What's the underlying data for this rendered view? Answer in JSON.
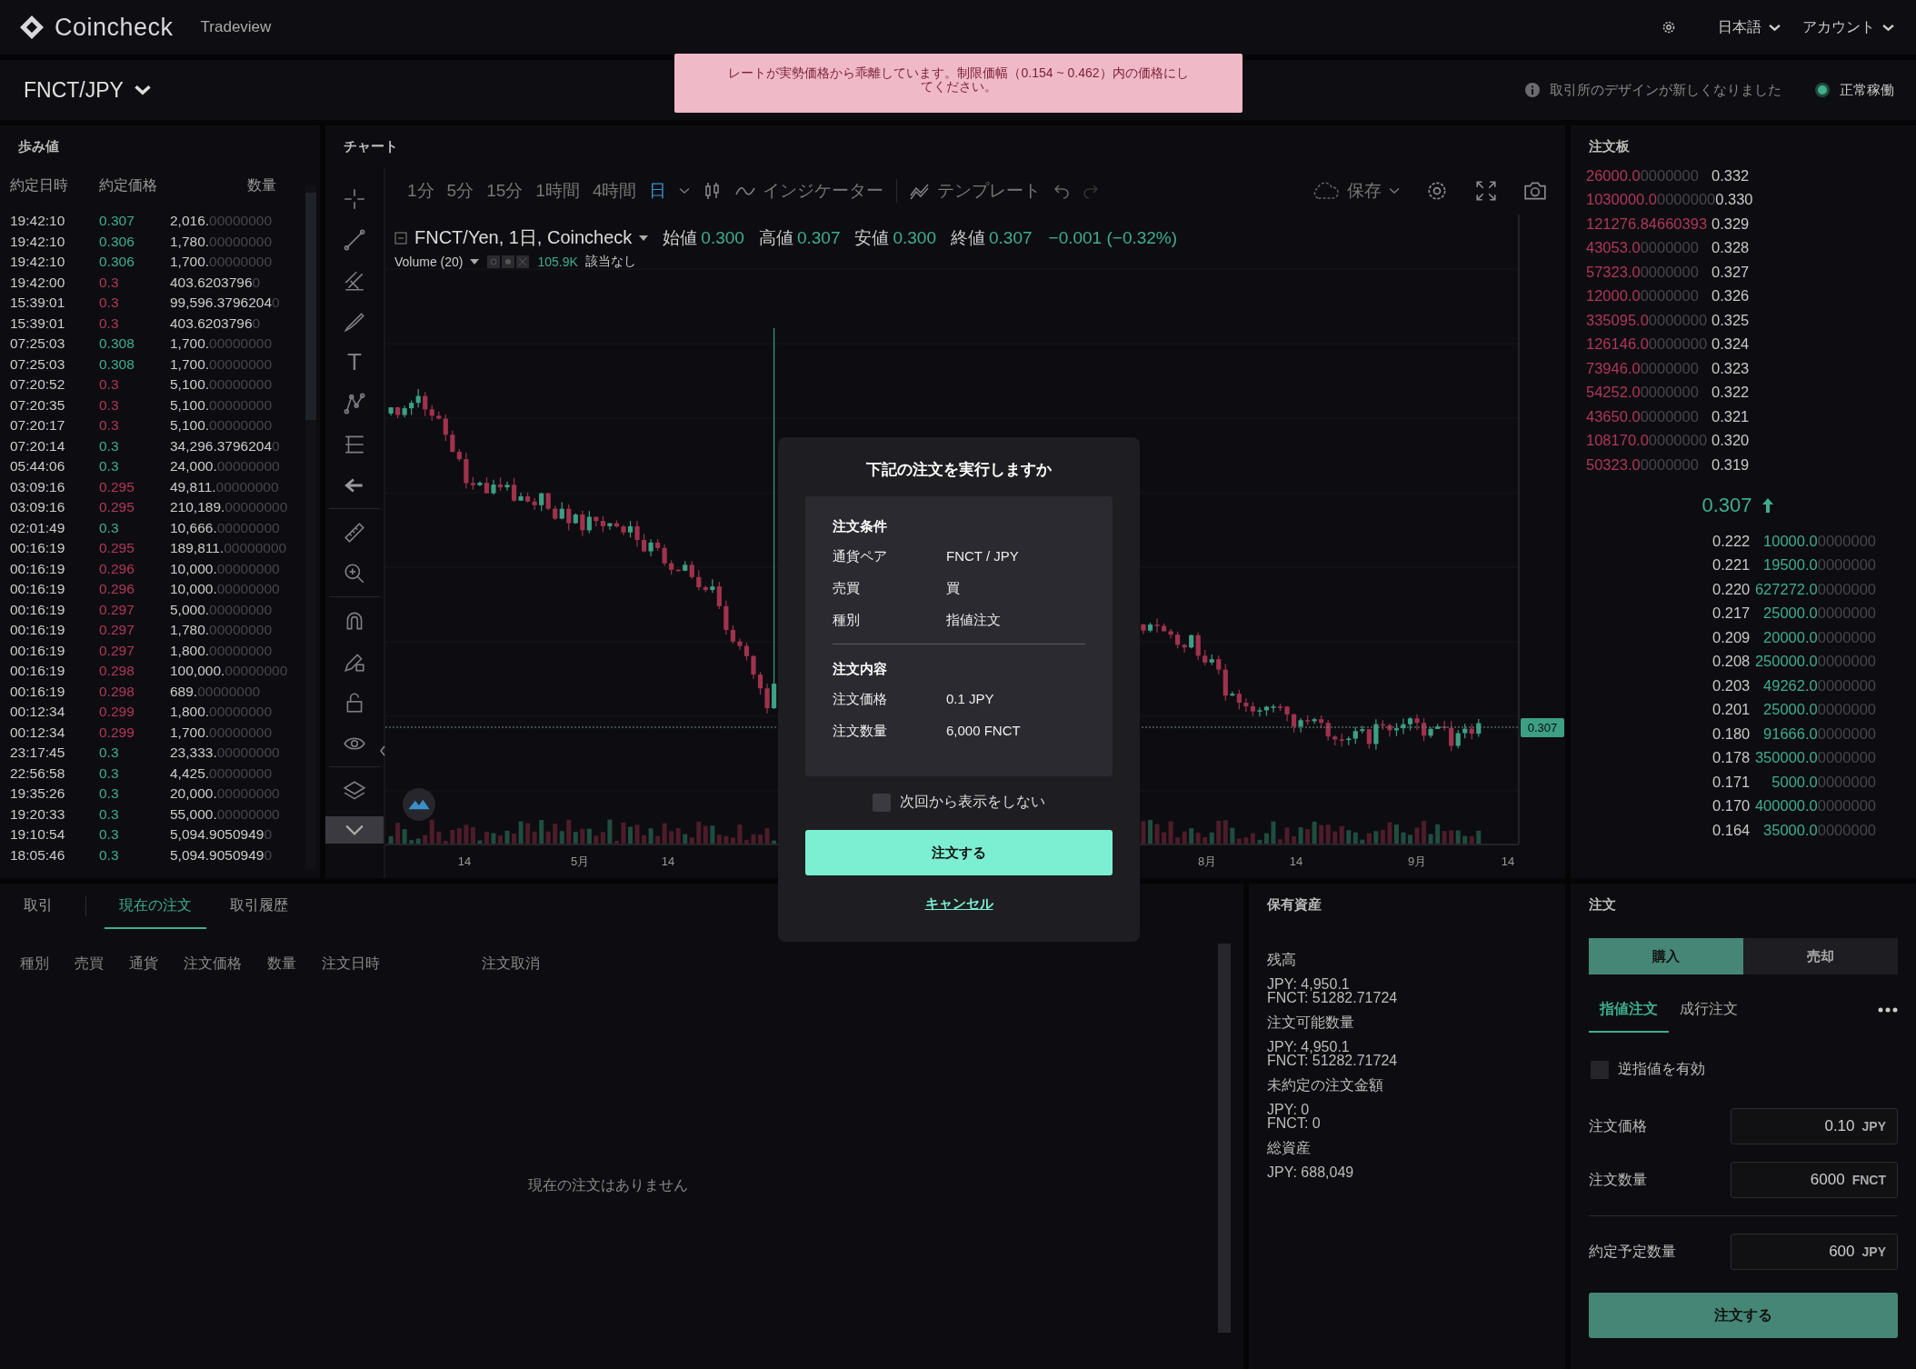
{
  "header": {
    "logo": "Coincheck",
    "app": "Tradeview",
    "language": "日本語",
    "account": "アカウント"
  },
  "pair_bar": {
    "pair": "FNCT/JPY",
    "notice": "取引所のデザインが新しくなりました",
    "status": "正常稼働"
  },
  "alert": {
    "message": "レートが実勢価格から乖離しています。制限価幅（0.154 ~ 0.462）内の価格にしてください。"
  },
  "trades": {
    "title": "歩み値",
    "columns": [
      "約定日時",
      "約定価格",
      "数量"
    ],
    "rows": [
      {
        "time": "19:42:10",
        "price": "0.307",
        "kind": "buy",
        "qty": "2,016.",
        "zeros": "00000000"
      },
      {
        "time": "19:42:10",
        "price": "0.306",
        "kind": "buy",
        "qty": "1,780.",
        "zeros": "00000000"
      },
      {
        "time": "19:42:10",
        "price": "0.306",
        "kind": "buy",
        "qty": "1,700.",
        "zeros": "00000000"
      },
      {
        "time": "19:42:00",
        "price": "0.3",
        "kind": "sell",
        "qty": "403.6203796",
        "zeros": "0"
      },
      {
        "time": "15:39:01",
        "price": "0.3",
        "kind": "sell",
        "qty": "99,596.3796204",
        "zeros": "0"
      },
      {
        "time": "15:39:01",
        "price": "0.3",
        "kind": "sell",
        "qty": "403.6203796",
        "zeros": "0"
      },
      {
        "time": "07:25:03",
        "price": "0.308",
        "kind": "buy",
        "qty": "1,700.",
        "zeros": "00000000"
      },
      {
        "time": "07:25:03",
        "price": "0.308",
        "kind": "buy",
        "qty": "1,700.",
        "zeros": "00000000"
      },
      {
        "time": "07:20:52",
        "price": "0.3",
        "kind": "sell",
        "qty": "5,100.",
        "zeros": "00000000"
      },
      {
        "time": "07:20:35",
        "price": "0.3",
        "kind": "sell",
        "qty": "5,100.",
        "zeros": "00000000"
      },
      {
        "time": "07:20:17",
        "price": "0.3",
        "kind": "sell",
        "qty": "5,100.",
        "zeros": "00000000"
      },
      {
        "time": "07:20:14",
        "price": "0.3",
        "kind": "buy",
        "qty": "34,296.3796204",
        "zeros": "0"
      },
      {
        "time": "05:44:06",
        "price": "0.3",
        "kind": "buy",
        "qty": "24,000.",
        "zeros": "00000000"
      },
      {
        "time": "03:09:16",
        "price": "0.295",
        "kind": "sell",
        "qty": "49,811.",
        "zeros": "00000000"
      },
      {
        "time": "03:09:16",
        "price": "0.295",
        "kind": "sell",
        "qty": "210,189.",
        "zeros": "00000000"
      },
      {
        "time": "02:01:49",
        "price": "0.3",
        "kind": "buy",
        "qty": "10,666.",
        "zeros": "00000000"
      },
      {
        "time": "00:16:19",
        "price": "0.295",
        "kind": "sell",
        "qty": "189,811.",
        "zeros": "00000000"
      },
      {
        "time": "00:16:19",
        "price": "0.296",
        "kind": "sell",
        "qty": "10,000.",
        "zeros": "00000000"
      },
      {
        "time": "00:16:19",
        "price": "0.296",
        "kind": "sell",
        "qty": "10,000.",
        "zeros": "00000000"
      },
      {
        "time": "00:16:19",
        "price": "0.297",
        "kind": "sell",
        "qty": "5,000.",
        "zeros": "00000000"
      },
      {
        "time": "00:16:19",
        "price": "0.297",
        "kind": "sell",
        "qty": "1,780.",
        "zeros": "00000000"
      },
      {
        "time": "00:16:19",
        "price": "0.297",
        "kind": "sell",
        "qty": "1,800.",
        "zeros": "00000000"
      },
      {
        "time": "00:16:19",
        "price": "0.298",
        "kind": "sell",
        "qty": "100,000.",
        "zeros": "00000000"
      },
      {
        "time": "00:16:19",
        "price": "0.298",
        "kind": "sell",
        "qty": "689.",
        "zeros": "00000000"
      },
      {
        "time": "00:12:34",
        "price": "0.299",
        "kind": "sell",
        "qty": "1,800.",
        "zeros": "00000000"
      },
      {
        "time": "00:12:34",
        "price": "0.299",
        "kind": "sell",
        "qty": "1,700.",
        "zeros": "00000000"
      },
      {
        "time": "23:17:45",
        "price": "0.3",
        "kind": "buy",
        "qty": "23,333.",
        "zeros": "00000000"
      },
      {
        "time": "22:56:58",
        "price": "0.3",
        "kind": "buy",
        "qty": "4,425.",
        "zeros": "00000000"
      },
      {
        "time": "19:35:26",
        "price": "0.3",
        "kind": "buy",
        "qty": "20,000.",
        "zeros": "00000000"
      },
      {
        "time": "19:20:33",
        "price": "0.3",
        "kind": "buy",
        "qty": "55,000.",
        "zeros": "00000000"
      },
      {
        "time": "19:10:54",
        "price": "0.3",
        "kind": "buy",
        "qty": "5,094.9050949",
        "zeros": "0"
      },
      {
        "time": "18:05:46",
        "price": "0.3",
        "kind": "buy",
        "qty": "5,094.9050949",
        "zeros": "0"
      }
    ]
  },
  "chart": {
    "title": "チャート",
    "intervals": [
      {
        "label": "1分",
        "selected": false
      },
      {
        "label": "5分",
        "selected": false
      },
      {
        "label": "15分",
        "selected": false
      },
      {
        "label": "1時間",
        "selected": false
      },
      {
        "label": "4時間",
        "selected": false
      },
      {
        "label": "日",
        "selected": true
      }
    ],
    "indicators": "インジケーター",
    "templates": "テンプレート",
    "save": "保存",
    "legend": {
      "symbol": "FNCT/Yen, 1日, Coincheck",
      "stats": [
        {
          "label": "始値",
          "value": "0.300"
        },
        {
          "label": "高値",
          "value": "0.307"
        },
        {
          "label": "安値",
          "value": "0.300"
        },
        {
          "label": "終値",
          "value": "0.307"
        }
      ],
      "change": "−0.001 (−0.32%)",
      "volume": "Volume (20)",
      "volume_value": "105.9K",
      "volume_note": "該当なし"
    },
    "x_labels": [
      "14",
      "5月",
      "14",
      "8月",
      "14",
      "9月",
      "14"
    ],
    "price_tag": "0.307",
    "tools": [
      {
        "kind": "crosshair"
      },
      {
        "kind": "line"
      },
      {
        "kind": "fork"
      },
      {
        "kind": "brush"
      },
      {
        "kind": "glyph",
        "glyph": "T"
      },
      {
        "kind": "nodes"
      },
      {
        "kind": "levels"
      },
      {
        "kind": "arrow"
      },
      {
        "kind": "divider"
      },
      {
        "kind": "ruler"
      },
      {
        "kind": "zoom"
      },
      {
        "kind": "divider"
      },
      {
        "kind": "magnet"
      },
      {
        "kind": "pencil-lock"
      },
      {
        "kind": "lock"
      },
      {
        "kind": "eye"
      },
      {
        "kind": "divider"
      },
      {
        "kind": "layers"
      },
      {
        "kind": "chevron"
      }
    ]
  },
  "orderbook": {
    "title": "注文板",
    "asks": [
      {
        "amount": "26000.0",
        "zeros": "0000000",
        "price": "0.332"
      },
      {
        "amount": "1030000.0",
        "zeros": "0000000",
        "price": "0.330"
      },
      {
        "amount": "121276.84660393",
        "price": "0.329"
      },
      {
        "amount": "43053.0",
        "zeros": "0000000",
        "price": "0.328"
      },
      {
        "amount": "57323.0",
        "zeros": "0000000",
        "price": "0.327"
      },
      {
        "amount": "12000.0",
        "zeros": "0000000",
        "price": "0.326"
      },
      {
        "amount": "335095.0",
        "zeros": "0000000",
        "price": "0.325"
      },
      {
        "amount": "126146.0",
        "zeros": "0000000",
        "price": "0.324"
      },
      {
        "amount": "73946.0",
        "zeros": "0000000",
        "price": "0.323"
      },
      {
        "amount": "54252.0",
        "zeros": "0000000",
        "price": "0.322"
      },
      {
        "amount": "43650.0",
        "zeros": "0000000",
        "price": "0.321"
      },
      {
        "amount": "108170.0",
        "zeros": "0000000",
        "price": "0.320"
      },
      {
        "amount": "50323.0",
        "zeros": "0000000",
        "price": "0.319"
      }
    ],
    "last_price": "0.307",
    "rising": true,
    "bids": [
      {
        "price": "0.222",
        "amount": "10000.0",
        "zeros": "0000000"
      },
      {
        "price": "0.221",
        "amount": "19500.0",
        "zeros": "0000000"
      },
      {
        "price": "0.220",
        "amount": "627272.0",
        "zeros": "0000000"
      },
      {
        "price": "0.217",
        "amount": "25000.0",
        "zeros": "0000000"
      },
      {
        "price": "0.209",
        "amount": "20000.0",
        "zeros": "0000000"
      },
      {
        "price": "0.208",
        "amount": "250000.0",
        "zeros": "0000000"
      },
      {
        "price": "0.203",
        "amount": "49262.0",
        "zeros": "0000000"
      },
      {
        "price": "0.201",
        "amount": "25000.0",
        "zeros": "0000000"
      },
      {
        "price": "0.180",
        "amount": "91666.0",
        "zeros": "0000000"
      },
      {
        "price": "0.178",
        "amount": "350000.0",
        "zeros": "0000000"
      },
      {
        "price": "0.171",
        "amount": "5000.0",
        "zeros": "0000000"
      },
      {
        "price": "0.170",
        "amount": "400000.0",
        "zeros": "0000000"
      },
      {
        "price": "0.164",
        "amount": "35000.0",
        "zeros": "0000000"
      }
    ]
  },
  "orders": {
    "tabs": [
      {
        "label": "取引",
        "selected": false
      },
      {
        "label": "現在の注文",
        "selected": true
      },
      {
        "label": "取引履歴",
        "selected": false
      }
    ],
    "columns": [
      "種別",
      "売買",
      "通貨",
      "注文価格",
      "数量",
      "注文日時",
      "注文取消"
    ],
    "empty": "現在の注文はありません"
  },
  "assets": {
    "title": "保有資産",
    "groups": [
      {
        "label": "残高",
        "lines": [
          "JPY: 4,950.1",
          "FNCT: 51282.71724"
        ]
      },
      {
        "label": "注文可能数量",
        "lines": [
          "JPY: 4,950.1",
          "FNCT: 51282.71724"
        ]
      },
      {
        "label": "未約定の注文金額",
        "lines": [
          "JPY: 0",
          "FNCT: 0"
        ]
      },
      {
        "label": "総資産",
        "lines": [
          "JPY: 688,049"
        ]
      }
    ]
  },
  "order_form": {
    "title": "注文",
    "sides": [
      {
        "label": "購入",
        "selected": true
      },
      {
        "label": "売却",
        "selected": false
      }
    ],
    "types": [
      {
        "label": "指値注文",
        "selected": true
      },
      {
        "label": "成行注文",
        "selected": false
      }
    ],
    "stop": {
      "label": "逆指値を有効",
      "checked": false
    },
    "fields": [
      {
        "label": "注文価格",
        "value": "0.10",
        "unit": "JPY"
      },
      {
        "label": "注文数量",
        "value": "6000",
        "unit": "FNCT"
      },
      {
        "label": "約定予定数量",
        "value": "600",
        "unit": "JPY"
      }
    ],
    "submit": "注文する"
  },
  "modal": {
    "title": "下記の注文を実行しますか",
    "sections": [
      {
        "heading": "注文条件",
        "rows": [
          {
            "label": "通貨ペア",
            "value": "FNCT / JPY"
          },
          {
            "label": "売買",
            "value": "買"
          },
          {
            "label": "種別",
            "value": "指値注文"
          }
        ]
      },
      {
        "heading": "注文内容",
        "rows": [
          {
            "label": "注文価格",
            "value": "0.1 JPY"
          },
          {
            "label": "注文数量",
            "value": "6,000 FNCT"
          }
        ]
      }
    ],
    "dont_show": {
      "label": "次回から表示をしない",
      "checked": false
    },
    "confirm": "注文する",
    "cancel": "キャンセル"
  }
}
